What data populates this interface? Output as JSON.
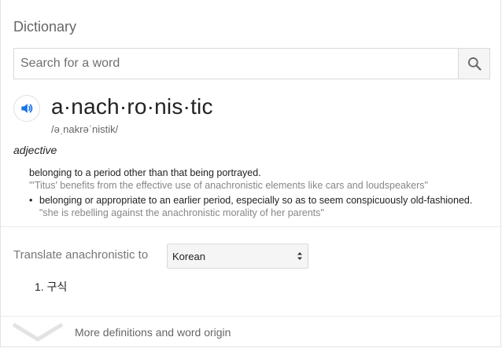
{
  "header": {
    "title": "Dictionary"
  },
  "search": {
    "placeholder": "Search for a word",
    "value": "",
    "icon": "search-icon"
  },
  "entry": {
    "speaker_icon": "speaker-icon",
    "word": "a·nach·ro·nis·tic",
    "phonetic": "/əˌnakrəˈnistik/",
    "part_of_speech": "adjective",
    "senses": [
      {
        "definition": "belonging to a period other than that being portrayed.",
        "example": "\"'Titus' benefits from the effective use of anachronistic elements like cars and loudspeakers\"",
        "subsenses": [
          {
            "bullet": "•",
            "definition": "belonging or appropriate to an earlier period, especially so as to seem conspicuously old-fashioned.",
            "example": "\"she is rebelling against the anachronistic morality of her parents\""
          }
        ]
      }
    ]
  },
  "translate": {
    "label": "Translate anachronistic to",
    "selected_language": "Korean",
    "results": [
      "1. 구식"
    ]
  },
  "footer": {
    "more_label": "More definitions and word origin",
    "icon": "chevron-down-icon"
  },
  "colors": {
    "accent": "#1a73e8",
    "muted_text": "#878787",
    "border": "#d9d9d9"
  }
}
